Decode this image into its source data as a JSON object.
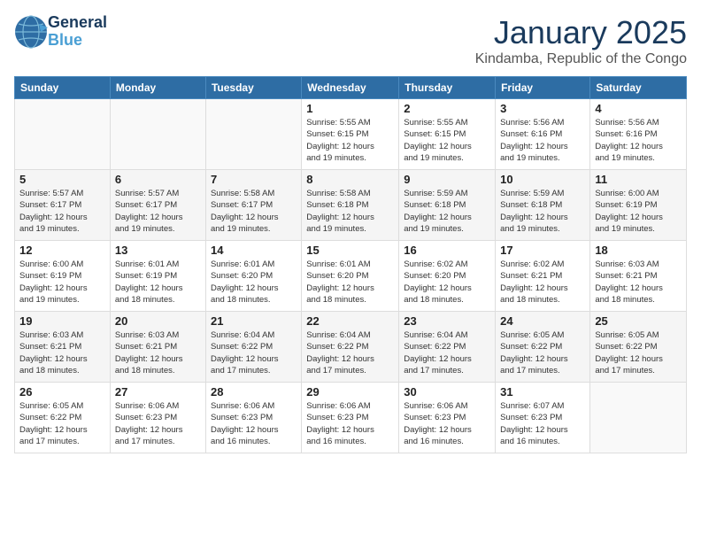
{
  "logo": {
    "general": "General",
    "blue": "Blue"
  },
  "header": {
    "month": "January 2025",
    "location": "Kindamba, Republic of the Congo"
  },
  "weekdays": [
    "Sunday",
    "Monday",
    "Tuesday",
    "Wednesday",
    "Thursday",
    "Friday",
    "Saturday"
  ],
  "weeks": [
    [
      {
        "day": "",
        "info": ""
      },
      {
        "day": "",
        "info": ""
      },
      {
        "day": "",
        "info": ""
      },
      {
        "day": "1",
        "info": "Sunrise: 5:55 AM\nSunset: 6:15 PM\nDaylight: 12 hours\nand 19 minutes."
      },
      {
        "day": "2",
        "info": "Sunrise: 5:55 AM\nSunset: 6:15 PM\nDaylight: 12 hours\nand 19 minutes."
      },
      {
        "day": "3",
        "info": "Sunrise: 5:56 AM\nSunset: 6:16 PM\nDaylight: 12 hours\nand 19 minutes."
      },
      {
        "day": "4",
        "info": "Sunrise: 5:56 AM\nSunset: 6:16 PM\nDaylight: 12 hours\nand 19 minutes."
      }
    ],
    [
      {
        "day": "5",
        "info": "Sunrise: 5:57 AM\nSunset: 6:17 PM\nDaylight: 12 hours\nand 19 minutes."
      },
      {
        "day": "6",
        "info": "Sunrise: 5:57 AM\nSunset: 6:17 PM\nDaylight: 12 hours\nand 19 minutes."
      },
      {
        "day": "7",
        "info": "Sunrise: 5:58 AM\nSunset: 6:17 PM\nDaylight: 12 hours\nand 19 minutes."
      },
      {
        "day": "8",
        "info": "Sunrise: 5:58 AM\nSunset: 6:18 PM\nDaylight: 12 hours\nand 19 minutes."
      },
      {
        "day": "9",
        "info": "Sunrise: 5:59 AM\nSunset: 6:18 PM\nDaylight: 12 hours\nand 19 minutes."
      },
      {
        "day": "10",
        "info": "Sunrise: 5:59 AM\nSunset: 6:18 PM\nDaylight: 12 hours\nand 19 minutes."
      },
      {
        "day": "11",
        "info": "Sunrise: 6:00 AM\nSunset: 6:19 PM\nDaylight: 12 hours\nand 19 minutes."
      }
    ],
    [
      {
        "day": "12",
        "info": "Sunrise: 6:00 AM\nSunset: 6:19 PM\nDaylight: 12 hours\nand 19 minutes."
      },
      {
        "day": "13",
        "info": "Sunrise: 6:01 AM\nSunset: 6:19 PM\nDaylight: 12 hours\nand 18 minutes."
      },
      {
        "day": "14",
        "info": "Sunrise: 6:01 AM\nSunset: 6:20 PM\nDaylight: 12 hours\nand 18 minutes."
      },
      {
        "day": "15",
        "info": "Sunrise: 6:01 AM\nSunset: 6:20 PM\nDaylight: 12 hours\nand 18 minutes."
      },
      {
        "day": "16",
        "info": "Sunrise: 6:02 AM\nSunset: 6:20 PM\nDaylight: 12 hours\nand 18 minutes."
      },
      {
        "day": "17",
        "info": "Sunrise: 6:02 AM\nSunset: 6:21 PM\nDaylight: 12 hours\nand 18 minutes."
      },
      {
        "day": "18",
        "info": "Sunrise: 6:03 AM\nSunset: 6:21 PM\nDaylight: 12 hours\nand 18 minutes."
      }
    ],
    [
      {
        "day": "19",
        "info": "Sunrise: 6:03 AM\nSunset: 6:21 PM\nDaylight: 12 hours\nand 18 minutes."
      },
      {
        "day": "20",
        "info": "Sunrise: 6:03 AM\nSunset: 6:21 PM\nDaylight: 12 hours\nand 18 minutes."
      },
      {
        "day": "21",
        "info": "Sunrise: 6:04 AM\nSunset: 6:22 PM\nDaylight: 12 hours\nand 17 minutes."
      },
      {
        "day": "22",
        "info": "Sunrise: 6:04 AM\nSunset: 6:22 PM\nDaylight: 12 hours\nand 17 minutes."
      },
      {
        "day": "23",
        "info": "Sunrise: 6:04 AM\nSunset: 6:22 PM\nDaylight: 12 hours\nand 17 minutes."
      },
      {
        "day": "24",
        "info": "Sunrise: 6:05 AM\nSunset: 6:22 PM\nDaylight: 12 hours\nand 17 minutes."
      },
      {
        "day": "25",
        "info": "Sunrise: 6:05 AM\nSunset: 6:22 PM\nDaylight: 12 hours\nand 17 minutes."
      }
    ],
    [
      {
        "day": "26",
        "info": "Sunrise: 6:05 AM\nSunset: 6:22 PM\nDaylight: 12 hours\nand 17 minutes."
      },
      {
        "day": "27",
        "info": "Sunrise: 6:06 AM\nSunset: 6:23 PM\nDaylight: 12 hours\nand 17 minutes."
      },
      {
        "day": "28",
        "info": "Sunrise: 6:06 AM\nSunset: 6:23 PM\nDaylight: 12 hours\nand 16 minutes."
      },
      {
        "day": "29",
        "info": "Sunrise: 6:06 AM\nSunset: 6:23 PM\nDaylight: 12 hours\nand 16 minutes."
      },
      {
        "day": "30",
        "info": "Sunrise: 6:06 AM\nSunset: 6:23 PM\nDaylight: 12 hours\nand 16 minutes."
      },
      {
        "day": "31",
        "info": "Sunrise: 6:07 AM\nSunset: 6:23 PM\nDaylight: 12 hours\nand 16 minutes."
      },
      {
        "day": "",
        "info": ""
      }
    ]
  ]
}
